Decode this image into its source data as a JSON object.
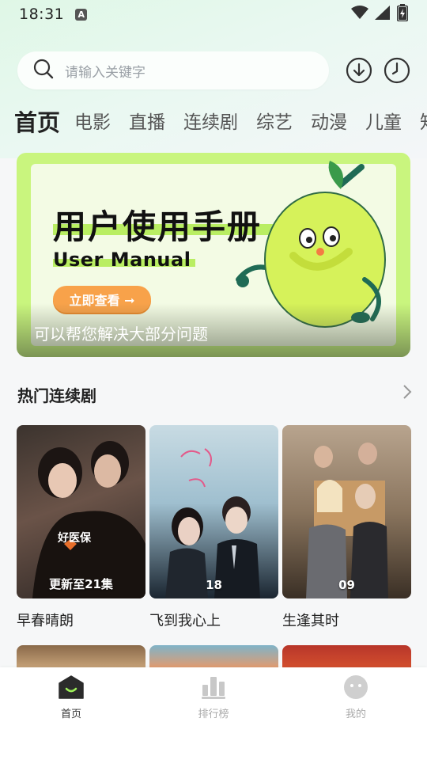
{
  "status_bar": {
    "time": "18:31",
    "a_badge": "A",
    "icons": [
      "wifi-icon",
      "signal-icon",
      "battery-charging-icon"
    ]
  },
  "search": {
    "placeholder": "请输入关键字",
    "search_icon": "search-icon",
    "download_icon": "download-icon",
    "history_icon": "clock-icon"
  },
  "tabs": [
    {
      "label": "首页",
      "active": true
    },
    {
      "label": "电影"
    },
    {
      "label": "直播"
    },
    {
      "label": "连续剧"
    },
    {
      "label": "综艺"
    },
    {
      "label": "动漫"
    },
    {
      "label": "儿童"
    },
    {
      "label": "知"
    }
  ],
  "banner": {
    "title": "用户使用手册",
    "subtitle": "User Manual",
    "button_label": "立即查看 ➞",
    "caption": "可以帮您解决大部分问题",
    "colors": {
      "frame": "#c9f57e",
      "button": "#f8a24a",
      "mascot": "#d6f25a"
    }
  },
  "section": {
    "title": "热门连续剧",
    "arrow_icon": "chevron-right-icon"
  },
  "cards": [
    {
      "title": "早春晴朗",
      "badge": "更新至21集",
      "poster_logo": "好医保"
    },
    {
      "title": "飞到我心上",
      "badge": "18"
    },
    {
      "title": "生逢其时",
      "badge": "09"
    }
  ],
  "bottom_nav": [
    {
      "label": "首页",
      "icon": "home-smile-icon",
      "active": true
    },
    {
      "label": "排行榜",
      "icon": "bar-chart-icon"
    },
    {
      "label": "我的",
      "icon": "profile-face-icon"
    }
  ]
}
